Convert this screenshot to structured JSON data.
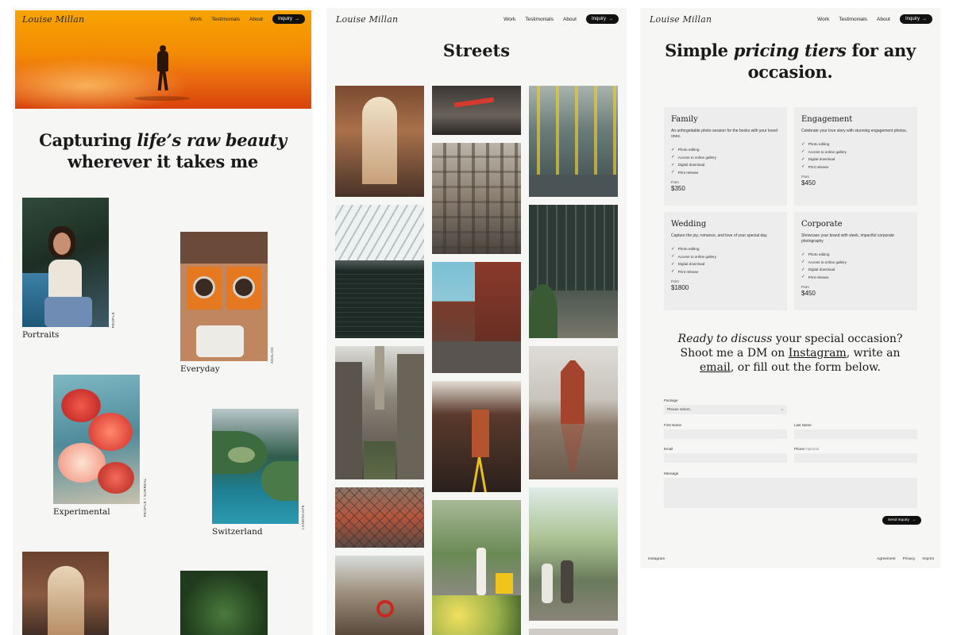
{
  "brand": {
    "logo": "Louise Millan"
  },
  "nav": {
    "work": "Work",
    "testimonials": "Testimonials",
    "about": "About",
    "inquiry": "Inquiry",
    "arrow": "→"
  },
  "home": {
    "headline_pre": "Capturing ",
    "headline_em": "life’s raw beauty",
    "headline_post": "wherever it takes me",
    "categories": [
      {
        "label": "Portraits",
        "tag": "PEOPLE"
      },
      {
        "label": "Everyday",
        "tag": "ANALOG"
      },
      {
        "label": "Experimental",
        "tag": "PEOPLE / SURREAL"
      },
      {
        "label": "Switzerland",
        "tag": "LANDSCAPE"
      }
    ]
  },
  "streets": {
    "title": "Streets"
  },
  "pricing": {
    "title_pre": "Simple ",
    "title_em": "pricing tiers",
    "title_post": " for any occasion.",
    "tiers": [
      {
        "name": "Family",
        "desc": "An unforgettable photo session for the books with your loved ones.",
        "features": [
          "Photo editing",
          "Access to online gallery",
          "Digital download",
          "Print release"
        ],
        "from": "From",
        "price": "$350"
      },
      {
        "name": "Engagement",
        "desc": "Celebrate your love story with stunning engagement photos.",
        "features": [
          "Photo editing",
          "Access to online gallery",
          "Digital download",
          "Print release"
        ],
        "from": "From",
        "price": "$450"
      },
      {
        "name": "Wedding",
        "desc": "Capture the joy, romance, and love of your special day.",
        "features": [
          "Photo editing",
          "Access to online gallery",
          "Digital download",
          "Print release"
        ],
        "from": "From",
        "price": "$1800"
      },
      {
        "name": "Corporate",
        "desc": "Showcase your brand with sleek, impactful corporate photography",
        "features": [
          "Photo editing",
          "Access to online gallery",
          "Digital download",
          "Print release"
        ],
        "from": "From",
        "price": "$450"
      }
    ],
    "cta_em": "Ready to discuss",
    "cta_1": " your special occasion?",
    "cta_2": "Shoot me a DM on ",
    "cta_instagram": "Instagram",
    "cta_3": ", write an",
    "cta_email": "email",
    "cta_4": ", or fill out the form below."
  },
  "form": {
    "package_label": "Package",
    "package_value": "Please select...",
    "first_name_label": "First Name",
    "last_name_label": "Last Name",
    "email_label": "Email",
    "phone_label": "Phone",
    "phone_optional": "Optional",
    "message_label": "Message",
    "send_label": "Send Inquiry"
  },
  "footer": {
    "instagram": "Instagram",
    "agreement": "Agreement",
    "privacy": "Privacy",
    "imprint": "Imprint"
  }
}
